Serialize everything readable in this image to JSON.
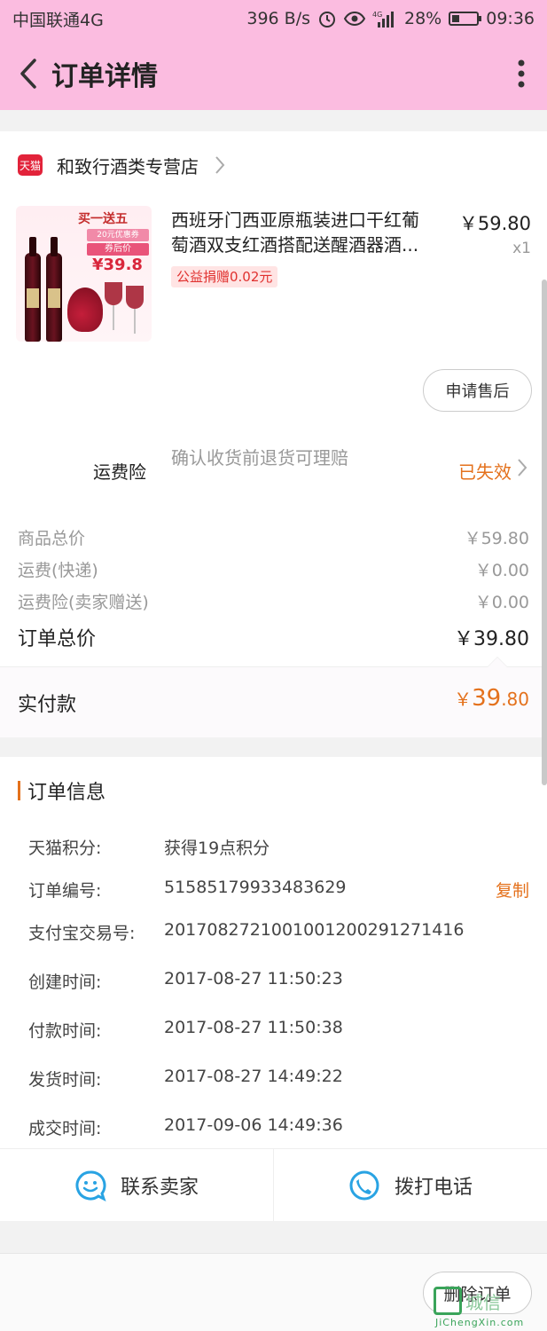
{
  "status_bar": {
    "carrier": "中国联通4G",
    "speed": "396 B/s",
    "battery": "28%",
    "time": "09:36"
  },
  "header": {
    "title": "订单详情"
  },
  "store": {
    "badge": "天猫",
    "name": "和致行酒类专营店"
  },
  "product": {
    "title_line1": "西班牙门西亚原瓶装进口干红葡",
    "title_line2": "萄酒双支红酒搭配送醒酒器酒...",
    "price": "￥59.80",
    "qty": "x1",
    "charity": "公益捐赠0.02元",
    "promo_title": "买一送五",
    "promo_coupon": "20元优惠券",
    "promo_after": "券后价",
    "promo_price": "¥39.8"
  },
  "after_sale_label": "申请售后",
  "insurance": {
    "label": "运费险",
    "desc": "确认收货前退货可理赔",
    "status": "已失效"
  },
  "prices": [
    {
      "label": "商品总价",
      "value": "￥59.80"
    },
    {
      "label": "运费(快递)",
      "value": "￥0.00"
    },
    {
      "label": "运费险(卖家赠送)",
      "value": "￥0.00"
    }
  ],
  "order_total": {
    "label": "订单总价",
    "value": "￥39.80"
  },
  "paid": {
    "label": "实付款",
    "yen": "￥",
    "int": "39",
    "dec": ".80"
  },
  "order_info": {
    "title": "订单信息",
    "rows": [
      {
        "key": "天猫积分:",
        "value": "获得19点积分"
      },
      {
        "key": "订单编号:",
        "value": "51585179933483629",
        "action": "复制"
      },
      {
        "key": "支付宝交易号:",
        "value": "2017082721001001200291271416"
      },
      {
        "key": "创建时间:",
        "value": "2017-08-27 11:50:23"
      },
      {
        "key": "付款时间:",
        "value": "2017-08-27 11:50:38"
      },
      {
        "key": "发货时间:",
        "value": "2017-08-27 14:49:22"
      },
      {
        "key": "成交时间:",
        "value": "2017-09-06 14:49:36"
      }
    ]
  },
  "actions": {
    "contact_seller": "联系卖家",
    "call_phone": "拨打电话"
  },
  "delete_order": "删除订单",
  "watermark": {
    "text": "城信",
    "domain": "JiChengXin.com"
  }
}
